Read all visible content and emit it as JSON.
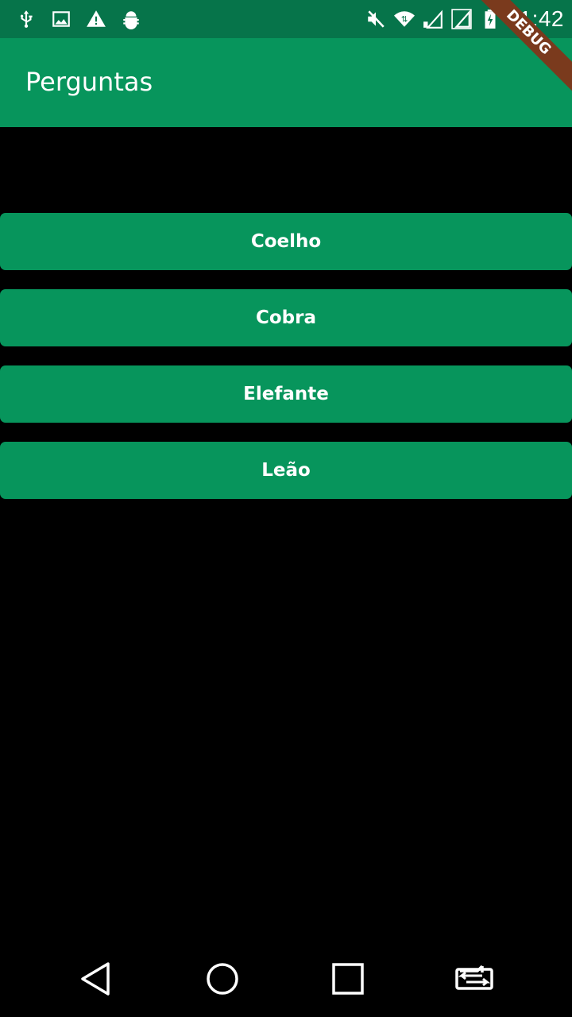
{
  "status_bar": {
    "time": "11:42",
    "left_icons": [
      "usb-icon",
      "image-icon",
      "warning-icon",
      "android-debug-icon"
    ],
    "right_icons": [
      "mute-icon",
      "wifi-icon",
      "signal-sim1-icon",
      "signal-sim2-icon",
      "battery-charging-icon"
    ]
  },
  "debug_banner": {
    "label": "DEBUG"
  },
  "app_bar": {
    "title": "Perguntas"
  },
  "answers": [
    "Coelho",
    "Cobra",
    "Elefante",
    "Leão"
  ],
  "nav_bar": {
    "icons": [
      "back-icon",
      "home-icon",
      "recents-icon",
      "switch-app-icon"
    ]
  },
  "colors": {
    "status_bar": "#06744a",
    "primary": "#07955c",
    "background": "#000000",
    "debug_banner": "#7a3a1d"
  }
}
